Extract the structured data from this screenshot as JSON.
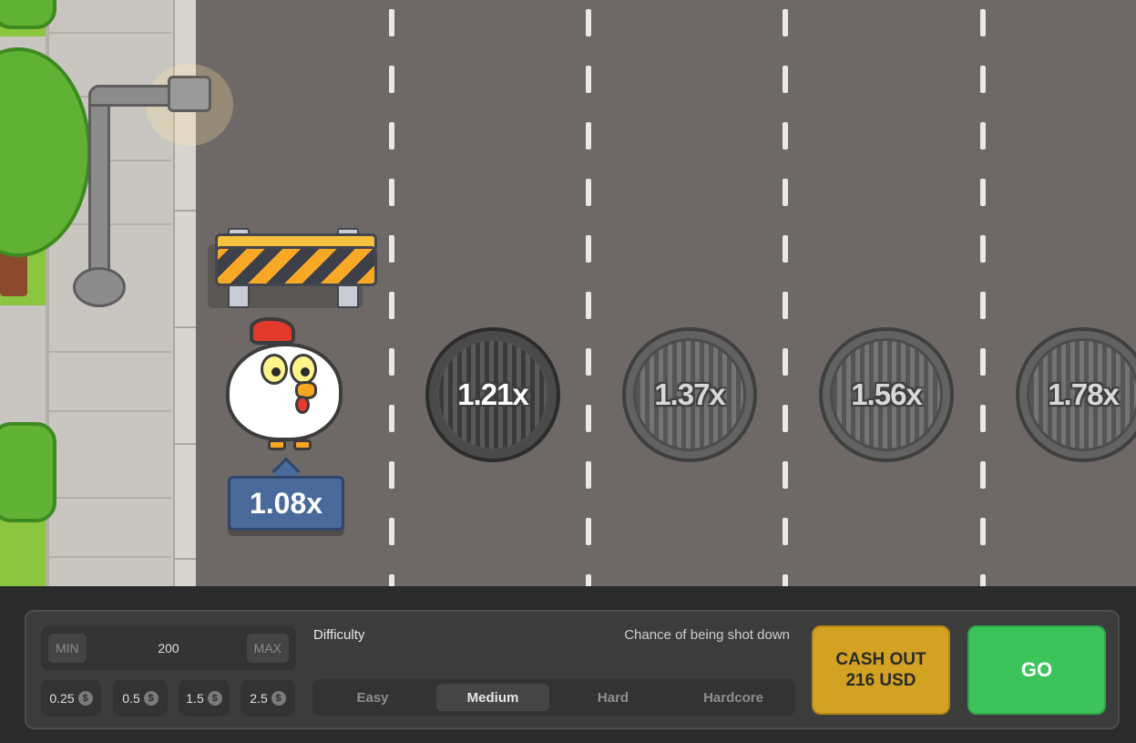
{
  "game": {
    "current_multiplier": "1.08x",
    "lane_multipliers": [
      {
        "label": "1.21x",
        "state": "next"
      },
      {
        "label": "1.37x",
        "state": "upcoming"
      },
      {
        "label": "1.56x",
        "state": "upcoming"
      },
      {
        "label": "1.78x",
        "state": "upcoming"
      }
    ]
  },
  "controls": {
    "bet": {
      "min_label": "MIN",
      "max_label": "MAX",
      "value": "200"
    },
    "quick_bets": [
      {
        "label": "0.25",
        "icon": "dollar-coin-icon"
      },
      {
        "label": "0.5",
        "icon": "dollar-coin-icon"
      },
      {
        "label": "1.5",
        "icon": "dollar-coin-icon"
      },
      {
        "label": "2.5",
        "icon": "dollar-coin-icon"
      }
    ],
    "coin_symbol": "$",
    "difficulty_label": "Difficulty",
    "chance_label": "Chance of being shot down",
    "difficulties": [
      "Easy",
      "Medium",
      "Hard",
      "Hardcore"
    ],
    "selected_difficulty": "Medium",
    "cashout_line1": "CASH OUT",
    "cashout_line2": "216 USD",
    "go_label": "GO"
  },
  "colors": {
    "road": "#6e6966",
    "panel": "#3c3c3c",
    "cashout": "#d4a223",
    "go": "#3cc35a",
    "badge": "#4a6a9c"
  }
}
